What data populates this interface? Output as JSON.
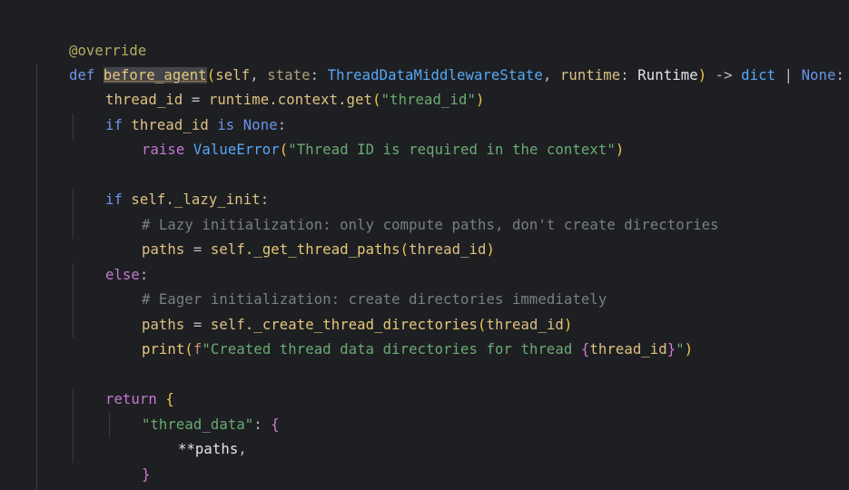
{
  "editor": {
    "lines": {
      "l1": {
        "decorator": "@override"
      },
      "l2": {
        "def_kw": "def",
        "fn_name": "before_agent",
        "open": "(",
        "self": "self",
        "comma1": ", ",
        "state_param": "state",
        "colon1": ": ",
        "state_type": "ThreadDataMiddlewareState",
        "comma2": ", ",
        "runtime_param": "runtime",
        "colon2": ": ",
        "runtime_type": "Runtime",
        "close": ")",
        "arrow": " -> ",
        "ret1": "dict",
        "pipe": " | ",
        "ret2": "None",
        "colon": ":"
      },
      "l3": {
        "var": "thread_id",
        "eq": " = ",
        "obj": "runtime.context.get",
        "open": "(",
        "str": "\"thread_id\"",
        "close": ")"
      },
      "l4": {
        "if": "if",
        "var": " thread_id ",
        "is": "is",
        "none": " None",
        "colon": ":"
      },
      "l5": {
        "raise": "raise",
        "exc": " ValueError",
        "open": "(",
        "str": "\"Thread ID is required in the context\"",
        "close": ")"
      },
      "l7": {
        "if": "if",
        "expr": " self._lazy_init",
        "colon": ":"
      },
      "l8": {
        "comment": "# Lazy initialization: only compute paths, don't create directories"
      },
      "l9": {
        "var": "paths",
        "eq": " = ",
        "self": "self.",
        "fn": "_get_thread_paths",
        "open": "(",
        "arg": "thread_id",
        "close": ")"
      },
      "l10": {
        "else": "else",
        "colon": ":"
      },
      "l11": {
        "comment": "# Eager initialization: create directories immediately"
      },
      "l12": {
        "var": "paths",
        "eq": " = ",
        "self": "self.",
        "fn": "_create_thread_directories",
        "open": "(",
        "arg": "thread_id",
        "close": ")"
      },
      "l13": {
        "fn": "print",
        "open": "(",
        "f": "f",
        "str1": "\"Created thread data directories for thread ",
        "lb": "{",
        "arg": "thread_id",
        "rb": "}",
        "str2": "\"",
        "close": ")"
      },
      "l15": {
        "return": "return",
        "brace": " {"
      },
      "l16": {
        "key": "\"thread_data\"",
        "colon": ": ",
        "brace": "{"
      },
      "l17": {
        "spread": "**paths",
        "comma": ","
      },
      "l18": {
        "brace": "}"
      },
      "l19": {
        "brace": "}"
      }
    }
  }
}
